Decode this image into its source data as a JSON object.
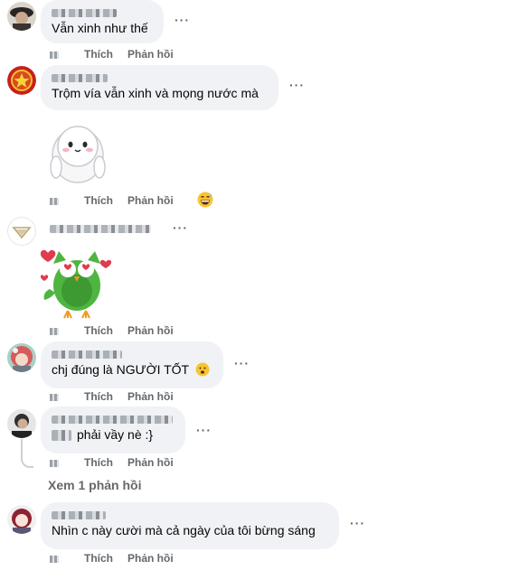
{
  "comments": [
    {
      "author": "",
      "text": "Vẫn xinh như thế",
      "avatar": "dark-hat-portrait",
      "actions": {
        "like": "Thích",
        "reply": "Phản hồi"
      },
      "more": "···"
    },
    {
      "author": "",
      "text": "Trộm vía vẫn xinh và mọng nước mà",
      "avatar": "red-star-emblem",
      "sticker": "white-blob-sticker",
      "actions": {
        "like": "Thích",
        "reply": "Phản hồi"
      },
      "reaction_emoji": "grinning-sweat-emoji",
      "more": "···"
    },
    {
      "author": "",
      "text": "",
      "avatar": "triangle-logo",
      "sticker": "green-owl-hearts-sticker",
      "actions": {
        "like": "Thích",
        "reply": "Phản hồi"
      },
      "more": "···"
    },
    {
      "author": "",
      "text": "chj đúng là NGƯỜI TỐT",
      "text_emoji": "😦",
      "avatar": "anime-girl",
      "actions": {
        "like": "Thích",
        "reply": "Phản hồi"
      },
      "more": "···"
    },
    {
      "author": "",
      "text": "phải vầy nè :}",
      "avatar": "dark-portrait",
      "actions": {
        "like": "Thích",
        "reply": "Phản hồi"
      },
      "view_replies": "Xem 1 phản hồi",
      "more": "···"
    },
    {
      "author": "",
      "text": "Nhìn c này cười mà cả ngày của tôi bừng sáng",
      "avatar": "red-hair-girl",
      "actions": {
        "like": "Thích",
        "reply": "Phản hồi"
      },
      "more": "···"
    }
  ],
  "colors": {
    "bubble": "#f0f2f5",
    "muted": "#65676b",
    "text": "#050505"
  }
}
